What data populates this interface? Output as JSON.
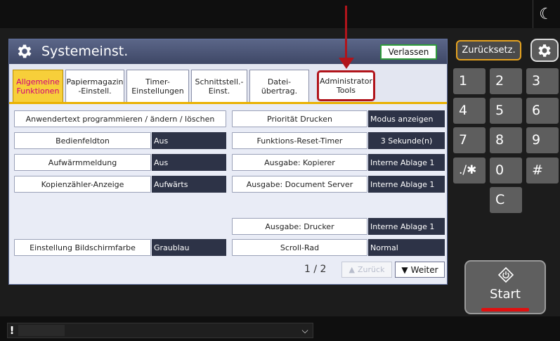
{
  "dialog": {
    "title": "Systemeinst.",
    "exit_label": "Verlassen"
  },
  "tabs": [
    {
      "label": "Allgemeine\nFunktionen",
      "selected": true
    },
    {
      "label": "Papiermagazin\n-Einstell.",
      "selected": false
    },
    {
      "label": "Timer-\nEinstellungen",
      "selected": false
    },
    {
      "label": "Schnittstell.-\nEinst.",
      "selected": false
    },
    {
      "label": "Datei-\nübertrag.",
      "selected": false
    },
    {
      "label": "Administrator\nTools",
      "selected": false
    }
  ],
  "left_settings": [
    {
      "label": "Anwendertext programmieren / ändern / löschen",
      "value": ""
    },
    {
      "label": "Bedienfeldton",
      "value": "Aus"
    },
    {
      "label": "Aufwärmmeldung",
      "value": "Aus"
    },
    {
      "label": "Kopienzähler-Anzeige",
      "value": "Aufwärts"
    },
    {
      "label": "Einstellung Bildschirmfarbe",
      "value": "Graublau"
    }
  ],
  "right_settings": [
    {
      "label": "Priorität Drucken",
      "value": "Modus anzeigen"
    },
    {
      "label": "Funktions-Reset-Timer",
      "value": "3  Sekunde(n)"
    },
    {
      "label": "Ausgabe: Kopierer",
      "value": "Interne Ablage 1"
    },
    {
      "label": "Ausgabe: Document Server",
      "value": "Interne Ablage 1"
    },
    {
      "label": "Ausgabe: Drucker",
      "value": "Interne Ablage 1"
    },
    {
      "label": "Scroll-Rad",
      "value": "Normal"
    }
  ],
  "pager": {
    "text": "1 ∕ 2",
    "back_label": "Zurück",
    "next_label": "Weiter"
  },
  "panel": {
    "reset_label": "Zurücksetz.",
    "keys": [
      "1",
      "2",
      "3",
      "4",
      "5",
      "6",
      "7",
      "8",
      "9",
      ".∕✱",
      "0",
      "#",
      "C"
    ],
    "start_label": "Start"
  },
  "status": {
    "alert": "!"
  },
  "colors": {
    "header": "#4a5475",
    "tab_selected": "#f7cf3a",
    "value_bg": "#2d3347",
    "highlight": "#b1141b",
    "reset_border": "#e5a21f",
    "start_bar": "#e01010"
  }
}
